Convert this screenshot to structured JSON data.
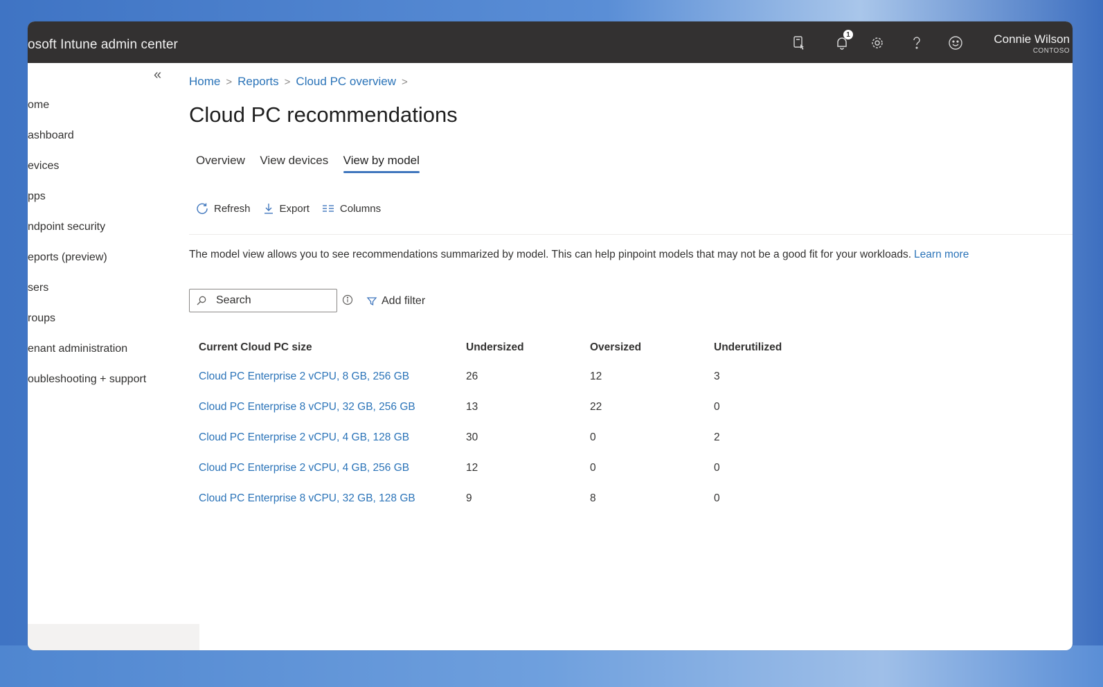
{
  "app": {
    "title": "osoft Intune admin center",
    "user_name": "Connie Wilson",
    "tenant": "CONTOSO",
    "notification_count": "1"
  },
  "sidebar": {
    "items": [
      {
        "label": "ome"
      },
      {
        "label": "ashboard"
      },
      {
        "label": "evices"
      },
      {
        "label": "pps"
      },
      {
        "label": "ndpoint security"
      },
      {
        "label": "eports (preview)"
      },
      {
        "label": "sers"
      },
      {
        "label": "roups"
      },
      {
        "label": "enant administration"
      },
      {
        "label": "oubleshooting + support"
      }
    ]
  },
  "breadcrumb": [
    "Home",
    "Reports",
    "Cloud PC overview"
  ],
  "page": {
    "title": "Cloud PC recommendations",
    "tabs": [
      {
        "label": "Overview",
        "active": false
      },
      {
        "label": "View devices",
        "active": false
      },
      {
        "label": "View by model",
        "active": true
      }
    ],
    "toolbar": {
      "refresh_label": "Refresh",
      "export_label": "Export",
      "columns_label": "Columns"
    },
    "description": "The model view allows you to see recommendations summarized by model. This can help pinpoint models that may not be a good fit for your workloads.",
    "learn_more": "Learn more",
    "search": {
      "placeholder": "Search"
    },
    "add_filter_label": "Add filter"
  },
  "table": {
    "headers": [
      "Current Cloud PC size",
      "Undersized",
      "Oversized",
      "Underutilized"
    ],
    "rows": [
      {
        "model": "Cloud PC Enterprise 2 vCPU, 8 GB, 256 GB",
        "undersized": "26",
        "oversized": "12",
        "underutilized": "3"
      },
      {
        "model": "Cloud PC Enterprise 8 vCPU, 32 GB, 256 GB",
        "undersized": "13",
        "oversized": "22",
        "underutilized": "0"
      },
      {
        "model": "Cloud PC Enterprise 2 vCPU, 4 GB, 128 GB",
        "undersized": "30",
        "oversized": "0",
        "underutilized": "2"
      },
      {
        "model": "Cloud PC Enterprise 2 vCPU, 4 GB, 256 GB",
        "undersized": "12",
        "oversized": "0",
        "underutilized": "0"
      },
      {
        "model": "Cloud PC Enterprise 8 vCPU, 32 GB, 128 GB",
        "undersized": "9",
        "oversized": "8",
        "underutilized": "0"
      }
    ]
  },
  "colors": {
    "topbar": "#333131",
    "link": "#2a73b8",
    "accent": "#3f76bd",
    "text": "#323130"
  },
  "icons": {
    "topbar": [
      "remote-device-icon",
      "notification-bell-icon",
      "settings-gear-icon",
      "help-icon",
      "feedback-smiley-icon"
    ],
    "toolbar": [
      "refresh-icon",
      "export-download-icon",
      "columns-icon"
    ]
  }
}
